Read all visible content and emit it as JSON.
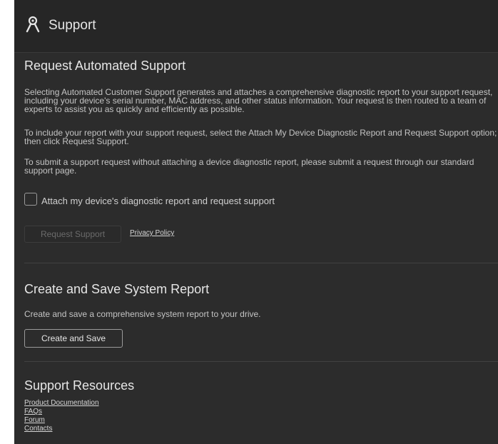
{
  "header": {
    "title": "Support",
    "icon": "user-icon"
  },
  "automated_support": {
    "title": "Request Automated Support",
    "paragraphs": [
      "Selecting Automated Customer Support generates and attaches a comprehensive diagnostic report to your support request, including your device's serial number, MAC address, and other status information. Your request is then routed to a team of experts to assist you as quickly and efficiently as possible.",
      "To include your report with your support request, select the Attach My Device Diagnostic Report and Request Support option; then click Request Support.",
      "To submit a support request without attaching a device diagnostic report, please submit a request through our standard support page."
    ],
    "checkbox_label": "Attach my device's diagnostic report and request support",
    "checkbox_checked": false,
    "request_button": "Request Support",
    "request_button_enabled": false,
    "privacy_link": "Privacy Policy"
  },
  "system_report": {
    "title": "Create and Save System Report",
    "description": "Create and save a comprehensive system report to your drive.",
    "button": "Create and Save"
  },
  "resources": {
    "title": "Support Resources",
    "links": [
      "Product Documentation",
      "FAQs",
      "Forum",
      "Contacts"
    ]
  },
  "colors": {
    "background": "#2c2c2c",
    "header": "#262626",
    "text": "#c4c4c4",
    "heading": "#e6e6e6"
  }
}
